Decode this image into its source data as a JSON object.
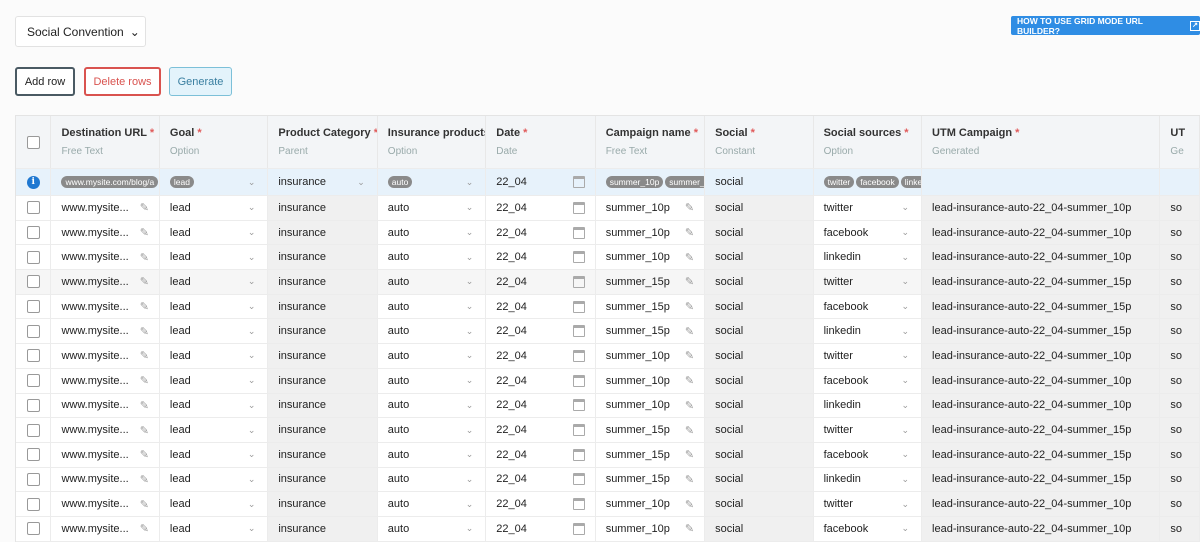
{
  "preset": {
    "label": "Social Convention"
  },
  "help": {
    "label": "HOW TO USE GRID MODE URL BUILDER?"
  },
  "toolbar": {
    "add": "Add row",
    "delete": "Delete rows",
    "generate": "Generate"
  },
  "columns": [
    {
      "title": "Destination URL",
      "req": true,
      "type": "Free Text"
    },
    {
      "title": "Goal",
      "req": true,
      "type": "Option"
    },
    {
      "title": "Product Category",
      "req": true,
      "type": "Parent"
    },
    {
      "title": "Insurance products",
      "req": false,
      "type": "Option"
    },
    {
      "title": "Date",
      "req": true,
      "type": "Date"
    },
    {
      "title": "Campaign name",
      "req": true,
      "type": "Free Text"
    },
    {
      "title": "Social",
      "req": true,
      "type": "Constant"
    },
    {
      "title": "Social sources",
      "req": true,
      "type": "Option"
    },
    {
      "title": "UTM Campaign",
      "req": true,
      "type": "Generated"
    },
    {
      "title": "UT",
      "req": false,
      "type": "Ge"
    }
  ],
  "filter_row": {
    "url": "www.mysite.com/blog/a",
    "goal": "lead",
    "product": "insurance",
    "insurance": "auto",
    "date": "22_04",
    "campaigns": [
      "summer_10p",
      "summer_"
    ],
    "social": "social",
    "sources": [
      "twitter",
      "facebook",
      "linke"
    ]
  },
  "rows": [
    {
      "url": "www.mysite...",
      "goal": "lead",
      "product": "insurance",
      "insurance": "auto",
      "date": "22_04",
      "campaign": "summer_10p",
      "social": "social",
      "source": "twitter",
      "utm": "lead-insurance-auto-22_04-summer_10p",
      "extra": "so"
    },
    {
      "url": "www.mysite...",
      "goal": "lead",
      "product": "insurance",
      "insurance": "auto",
      "date": "22_04",
      "campaign": "summer_10p",
      "social": "social",
      "source": "facebook",
      "utm": "lead-insurance-auto-22_04-summer_10p",
      "extra": "so"
    },
    {
      "url": "www.mysite...",
      "goal": "lead",
      "product": "insurance",
      "insurance": "auto",
      "date": "22_04",
      "campaign": "summer_10p",
      "social": "social",
      "source": "linkedin",
      "utm": "lead-insurance-auto-22_04-summer_10p",
      "extra": "so"
    },
    {
      "url": "www.mysite...",
      "goal": "lead",
      "product": "insurance",
      "insurance": "auto",
      "date": "22_04",
      "campaign": "summer_15p",
      "social": "social",
      "source": "twitter",
      "utm": "lead-insurance-auto-22_04-summer_15p",
      "extra": "so"
    },
    {
      "url": "www.mysite...",
      "goal": "lead",
      "product": "insurance",
      "insurance": "auto",
      "date": "22_04",
      "campaign": "summer_15p",
      "social": "social",
      "source": "facebook",
      "utm": "lead-insurance-auto-22_04-summer_15p",
      "extra": "so"
    },
    {
      "url": "www.mysite...",
      "goal": "lead",
      "product": "insurance",
      "insurance": "auto",
      "date": "22_04",
      "campaign": "summer_15p",
      "social": "social",
      "source": "linkedin",
      "utm": "lead-insurance-auto-22_04-summer_15p",
      "extra": "so"
    },
    {
      "url": "www.mysite...",
      "goal": "lead",
      "product": "insurance",
      "insurance": "auto",
      "date": "22_04",
      "campaign": "summer_10p",
      "social": "social",
      "source": "twitter",
      "utm": "lead-insurance-auto-22_04-summer_10p",
      "extra": "so"
    },
    {
      "url": "www.mysite...",
      "goal": "lead",
      "product": "insurance",
      "insurance": "auto",
      "date": "22_04",
      "campaign": "summer_10p",
      "social": "social",
      "source": "facebook",
      "utm": "lead-insurance-auto-22_04-summer_10p",
      "extra": "so"
    },
    {
      "url": "www.mysite...",
      "goal": "lead",
      "product": "insurance",
      "insurance": "auto",
      "date": "22_04",
      "campaign": "summer_10p",
      "social": "social",
      "source": "linkedin",
      "utm": "lead-insurance-auto-22_04-summer_10p",
      "extra": "so"
    },
    {
      "url": "www.mysite...",
      "goal": "lead",
      "product": "insurance",
      "insurance": "auto",
      "date": "22_04",
      "campaign": "summer_15p",
      "social": "social",
      "source": "twitter",
      "utm": "lead-insurance-auto-22_04-summer_15p",
      "extra": "so"
    },
    {
      "url": "www.mysite...",
      "goal": "lead",
      "product": "insurance",
      "insurance": "auto",
      "date": "22_04",
      "campaign": "summer_15p",
      "social": "social",
      "source": "facebook",
      "utm": "lead-insurance-auto-22_04-summer_15p",
      "extra": "so"
    },
    {
      "url": "www.mysite...",
      "goal": "lead",
      "product": "insurance",
      "insurance": "auto",
      "date": "22_04",
      "campaign": "summer_15p",
      "social": "social",
      "source": "linkedin",
      "utm": "lead-insurance-auto-22_04-summer_15p",
      "extra": "so"
    },
    {
      "url": "www.mysite...",
      "goal": "lead",
      "product": "insurance",
      "insurance": "auto",
      "date": "22_04",
      "campaign": "summer_10p",
      "social": "social",
      "source": "twitter",
      "utm": "lead-insurance-auto-22_04-summer_10p",
      "extra": "so"
    },
    {
      "url": "www.mysite...",
      "goal": "lead",
      "product": "insurance",
      "insurance": "auto",
      "date": "22_04",
      "campaign": "summer_10p",
      "social": "social",
      "source": "facebook",
      "utm": "lead-insurance-auto-22_04-summer_10p",
      "extra": "so"
    }
  ]
}
